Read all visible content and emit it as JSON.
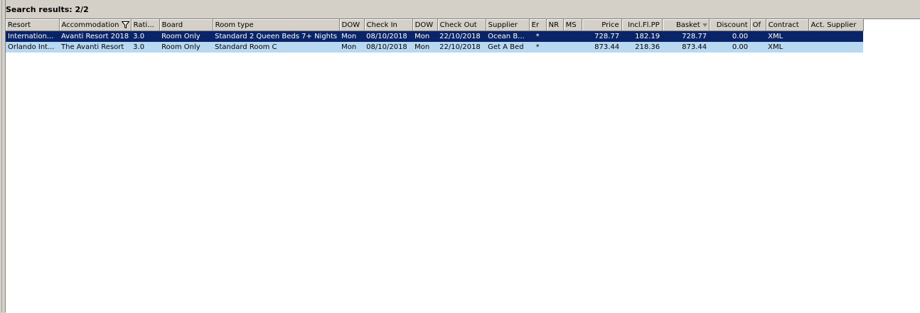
{
  "title": "Search results: 2/2",
  "columns": [
    {
      "label": "Resort"
    },
    {
      "label": "Accommodation"
    },
    {
      "label": "Rati..."
    },
    {
      "label": "Board"
    },
    {
      "label": "Room type"
    },
    {
      "label": "DOW"
    },
    {
      "label": "Check In"
    },
    {
      "label": "DOW"
    },
    {
      "label": "Check Out"
    },
    {
      "label": "Supplier"
    },
    {
      "label": "Er"
    },
    {
      "label": "NR"
    },
    {
      "label": "MS"
    },
    {
      "label": "Price"
    },
    {
      "label": "Incl.Fl.PP"
    },
    {
      "label": "Basket"
    },
    {
      "label": "Discount"
    },
    {
      "label": "Of"
    },
    {
      "label": "Contract"
    },
    {
      "label": "Act. Supplier"
    }
  ],
  "rows": [
    {
      "selected": true,
      "cells": [
        "Internation...",
        "Avanti Resort 2018",
        "3.0",
        "Room Only",
        "Standard 2 Queen Beds 7+  Nights",
        "Mon",
        "08/10/2018",
        "Mon",
        "22/10/2018",
        "Ocean B...",
        "*",
        "",
        "",
        "728.77",
        "182.19",
        "728.77",
        "0.00",
        "",
        "XML",
        ""
      ]
    },
    {
      "selected": false,
      "cells": [
        "Orlando Int...",
        "The Avanti Resort",
        "3.0",
        "Room Only",
        "Standard Room C",
        "Mon",
        "08/10/2018",
        "Mon",
        "22/10/2018",
        "Get A Bed",
        "*",
        "",
        "",
        "873.44",
        "218.36",
        "873.44",
        "0.00",
        "",
        "XML",
        ""
      ]
    }
  ],
  "colors": {
    "selected_row": "#0a246a",
    "alt_row": "#b9d9f3",
    "header_bg": "#d4d0c8"
  }
}
